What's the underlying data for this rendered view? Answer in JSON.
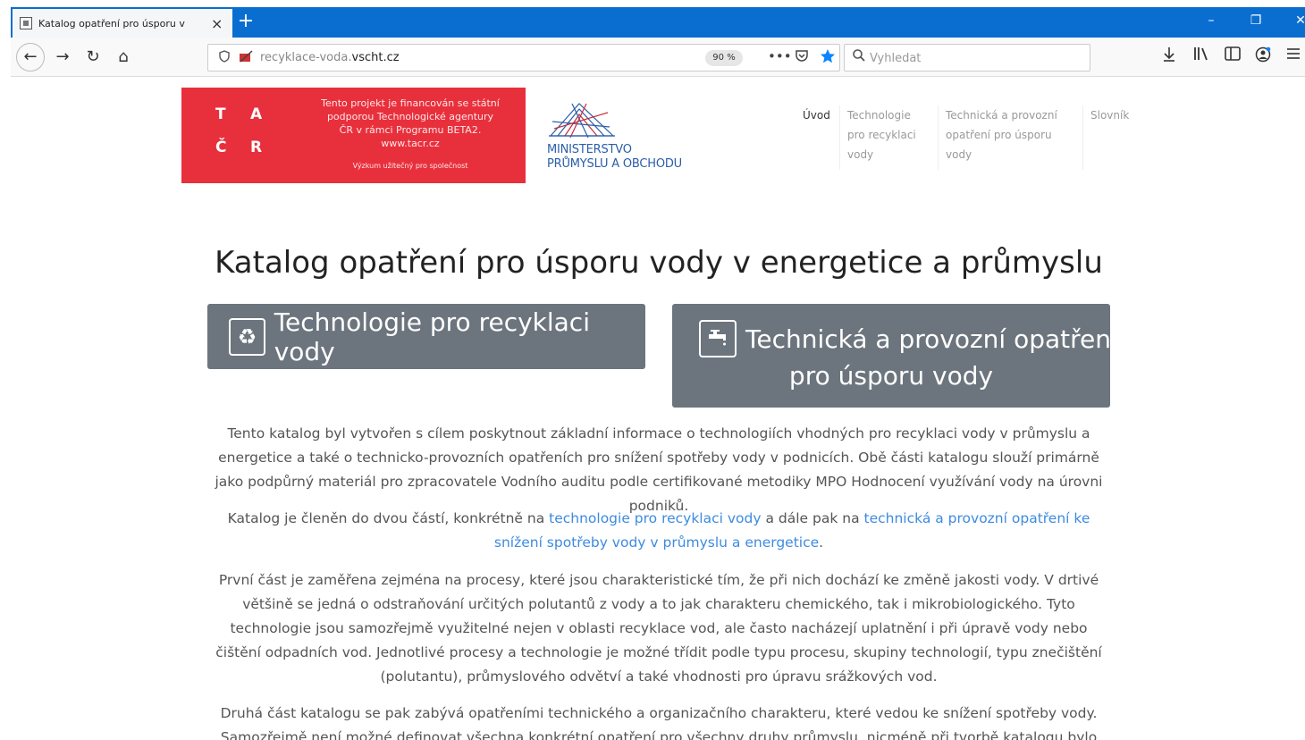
{
  "browser": {
    "tab_title": "Katalog opatření pro úsporu v",
    "tab_close": "×",
    "new_tab": "+",
    "window_controls": {
      "minimize": "–",
      "restore": "❐",
      "close": "✕"
    },
    "nav": {
      "back": "←",
      "forward": "→",
      "reload": "↻",
      "home": "⌂"
    },
    "url_prefix": "recyklace-voda.",
    "url_domain": "vscht.cz",
    "zoom": "90 %",
    "page_actions": "•••",
    "search_placeholder": "Vyhledat",
    "icons": {
      "shield": "shield-icon",
      "site": "site-permissions-icon",
      "pocket": "pocket-icon",
      "bookmark": "bookmark-star-icon",
      "download": "download-icon",
      "library": "library-icon",
      "sidebar": "sidebar-icon",
      "account": "account-icon",
      "menu": "menu-icon"
    }
  },
  "banner": {
    "letters": [
      "T",
      "A",
      "Č",
      "R"
    ],
    "text_lines": [
      "Tento projekt je financován se státní",
      "podporou Technologické agentury",
      "ČR v rámci Programu BETA2.",
      "www.tacr.cz"
    ],
    "small": "Výzkum užitečný pro společnost",
    "color": "#e8303c"
  },
  "mpo_logo": {
    "line1": "MINISTERSTVO",
    "line2": "PRŮMYSLU A OBCHODU",
    "color": "#2a5ea8"
  },
  "site_nav": [
    {
      "label": "Úvod"
    },
    {
      "label": "Technologie pro recyklaci vody"
    },
    {
      "label": "Technická a provozní opatření pro úsporu vody"
    },
    {
      "label": "Slovník"
    }
  ],
  "page_title": "Katalog opatření pro úsporu vody v energetice a průmyslu",
  "buttons": {
    "recycle": {
      "label": "Technologie pro recyklaci vody",
      "icon": "recycle-icon"
    },
    "tech": {
      "line1": "Technická a provozní opatření",
      "line2": "pro úsporu vody",
      "icon": "faucet-icon"
    }
  },
  "paragraphs": {
    "p1": "Tento katalog byl vytvořen s cílem poskytnout základní informace o technologiích vhodných pro recyklaci vody v průmyslu a energetice a také o technicko-provozních opatřeních pro snížení spotřeby vody v podnicích. Obě části katalogu slouží primárně jako podpůrný materiál pro zpracovatele Vodního auditu podle certifikované metodiky MPO Hodnocení využívání vody na úrovni podniků.",
    "p2_pre": "Katalog je členěn do dvou částí, konkrétně na ",
    "p2_link1": "technologie pro recyklaci vody",
    "p2_mid": " a dále pak na ",
    "p2_link2": "technická a provozní opatření ke snížení spotřeby vody v průmyslu a energetice",
    "p2_post": ".",
    "p3": "První část je zaměřena zejména na procesy, které jsou charakteristické tím, že při nich dochází ke změně jakosti vody. V drtivé většině se jedná o odstraňování určitých polutantů z vody a to jak charakteru chemického, tak i mikrobiologického. Tyto technologie jsou samozřejmě využitelné nejen v oblasti recyklace vod, ale často nacházejí uplatnění i při úpravě vody nebo čištění odpadních vod. Jednotlivé procesy a technologie je možné třídit podle typu procesu, skupiny technologií, typu znečištění (polutantu), průmyslového odvětví a také vhodnosti pro úpravu srážkových vod.",
    "p4": "Druhá část katalogu se pak zabývá opatřeními technického a organizačního charakteru, které vedou ke snížení spotřeby vody. Samozřejmě není možné definovat všechna konkrétní opatření pro všechny druhy průmyslu, nicméně při tvorbě katalogu bylo cílem"
  },
  "colors": {
    "chrome_blue": "#0a6ed1",
    "button_gray": "#6c757d",
    "link": "#3d8be0"
  }
}
